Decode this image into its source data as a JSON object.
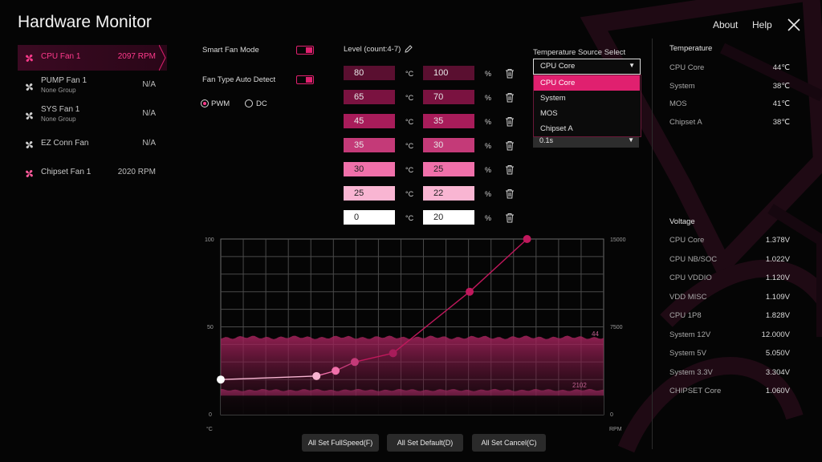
{
  "window": {
    "title": "Hardware Monitor",
    "about": "About",
    "help": "Help"
  },
  "fans": [
    {
      "name": "CPU Fan 1",
      "group": "",
      "rpm": "2097 RPM",
      "active": true
    },
    {
      "name": "PUMP Fan 1",
      "group": "None Group",
      "rpm": "N/A"
    },
    {
      "name": "SYS Fan 1",
      "group": "None Group",
      "rpm": "N/A"
    },
    {
      "name": "EZ Conn Fan",
      "group": "",
      "rpm": "N/A"
    },
    {
      "name": "Chipset Fan 1",
      "group": "",
      "rpm": "2020 RPM"
    }
  ],
  "settings": {
    "smart_fan_mode": "Smart Fan Mode",
    "fan_type_auto": "Fan Type Auto Detect",
    "pwm": "PWM",
    "dc": "DC"
  },
  "levels": {
    "title": "Level (count:4-7)",
    "temp_unit": "°C",
    "pct_unit": "%",
    "rows": [
      {
        "temp": "80",
        "pct": "100",
        "color": "#5a0f30"
      },
      {
        "temp": "65",
        "pct": "70",
        "color": "#7a1240"
      },
      {
        "temp": "45",
        "pct": "35",
        "color": "#a81c5a"
      },
      {
        "temp": "35",
        "pct": "30",
        "color": "#c43a78"
      },
      {
        "temp": "30",
        "pct": "25",
        "color": "#f070aa"
      },
      {
        "temp": "25",
        "pct": "22",
        "color": "#f9b5d2"
      },
      {
        "temp": "0",
        "pct": "20",
        "color": "#ffffff"
      }
    ]
  },
  "temp_source": {
    "label": "Temperature Source Select",
    "selected": "CPU Core",
    "options": [
      "CPU Core",
      "System",
      "MOS",
      "Chipset A"
    ],
    "interval": "0.1s"
  },
  "temperature": {
    "title": "Temperature",
    "items": [
      {
        "name": "CPU Core",
        "value": "44℃"
      },
      {
        "name": "System",
        "value": "38℃"
      },
      {
        "name": "MOS",
        "value": "41℃"
      },
      {
        "name": "Chipset A",
        "value": "38℃"
      }
    ]
  },
  "voltage": {
    "title": "Voltage",
    "items": [
      {
        "name": "CPU Core",
        "value": "1.378V"
      },
      {
        "name": "CPU NB/SOC",
        "value": "1.022V"
      },
      {
        "name": "CPU VDDIO",
        "value": "1.120V"
      },
      {
        "name": "VDD MISC",
        "value": "1.109V"
      },
      {
        "name": "CPU 1P8",
        "value": "1.828V"
      },
      {
        "name": "System 12V",
        "value": "12.000V"
      },
      {
        "name": "System 5V",
        "value": "5.050V"
      },
      {
        "name": "System 3.3V",
        "value": "3.304V"
      },
      {
        "name": "CHIPSET Core",
        "value": "1.060V"
      }
    ]
  },
  "chart": {
    "left_ticks": [
      "100",
      "50",
      "0"
    ],
    "right_ticks": [
      "15000",
      "7500",
      "0"
    ],
    "x_unit": "°C",
    "rpm_unit": "RPM",
    "temp_readout": "44",
    "rpm_readout": "2102",
    "curve_color": "#c0185c"
  },
  "chart_data": {
    "type": "line",
    "xlabel": "°C",
    "ylabel": "",
    "xlim": [
      0,
      100
    ],
    "ylim": [
      0,
      100
    ],
    "y2lim": [
      0,
      15000
    ],
    "grid": true,
    "series": [
      {
        "x": [
          0,
          25,
          30,
          35,
          45,
          65,
          80
        ],
        "y": [
          20,
          22,
          25,
          30,
          35,
          70,
          100
        ]
      }
    ],
    "temperature_history_level": 44,
    "rpm_history_level": 2102
  },
  "buttons": {
    "fullspeed": "All Set FullSpeed(F)",
    "default": "All Set Default(D)",
    "cancel": "All Set Cancel(C)"
  }
}
